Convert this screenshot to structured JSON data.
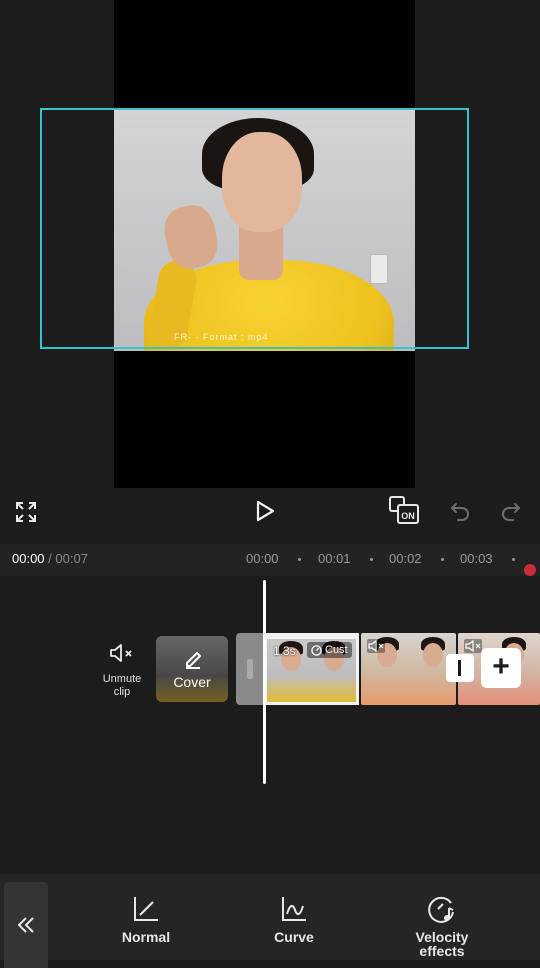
{
  "player": {
    "current_time": "00:00",
    "separator": "/",
    "total_time": "00:07",
    "ruler_ticks": [
      "00:00",
      "00:01",
      "00:02",
      "00:03"
    ],
    "video_overlay_text": "FR·  ·         Format : mp4"
  },
  "timeline": {
    "unmute_label": "Unmute clip",
    "cover_label": "Cover",
    "selected_clip": {
      "duration": "1.3s",
      "speed_badge": "Cust"
    }
  },
  "speed_tools": {
    "items": [
      {
        "label": "Normal",
        "icon": "normal-speed-icon"
      },
      {
        "label": "Curve",
        "icon": "curve-speed-icon"
      },
      {
        "label": "Velocity effects",
        "icon": "velocity-effects-icon"
      }
    ]
  },
  "colors": {
    "background": "#1c1c1c",
    "selection_accent": "#36c4cc",
    "record_indicator": "#c92b3a",
    "bottom_bar": "#252525"
  },
  "icons": {
    "fullscreen": "fullscreen-icon",
    "play": "play-icon",
    "compare": "compare-on-icon",
    "compare_badge": "ON",
    "undo": "undo-icon",
    "redo": "redo-icon",
    "mute": "speaker-muted-icon",
    "cover_edit": "pencil-icon",
    "add": "plus-icon",
    "back": "double-chevron-left-icon"
  }
}
